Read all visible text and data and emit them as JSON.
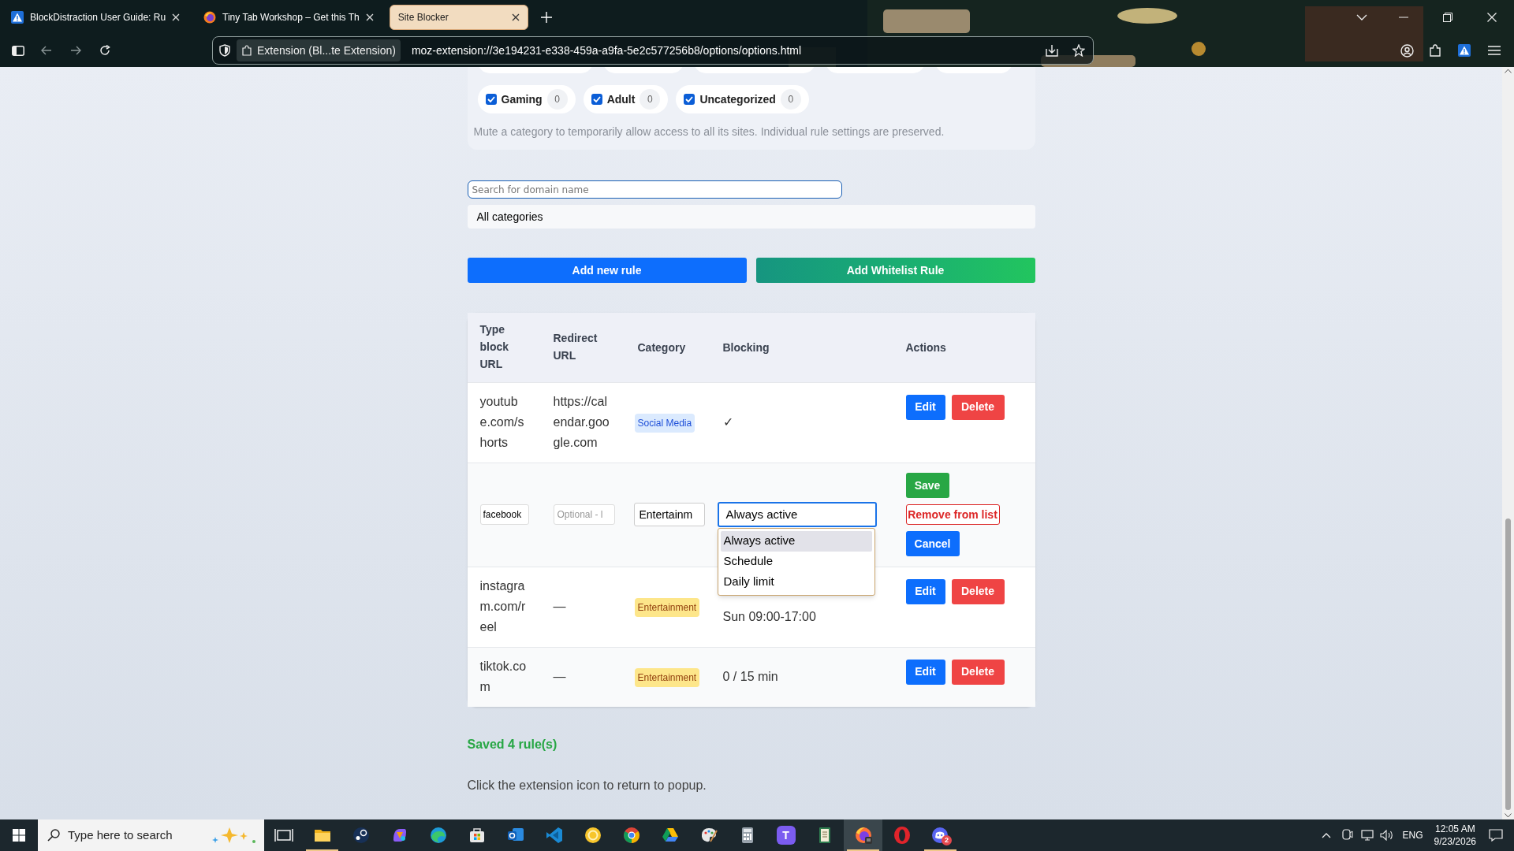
{
  "browser": {
    "tabs": [
      {
        "title": "BlockDistraction User Guide: Ru",
        "selected": false
      },
      {
        "title": "Tiny Tab Workshop – Get this Th",
        "selected": false
      },
      {
        "title": "Site Blocker",
        "selected": true
      }
    ],
    "identity": "Extension (Bl...te Extension)",
    "url": "moz-extension://3e194231-e338-459a-a9fa-5e2c577256b8/options/options.html"
  },
  "category_filters": [
    {
      "label": "Gaming",
      "count": "0",
      "checked": true
    },
    {
      "label": "Adult",
      "count": "0",
      "checked": true
    },
    {
      "label": "Uncategorized",
      "count": "0",
      "checked": true
    }
  ],
  "mute_note": "Mute a category to temporarily allow access to all its sites. Individual rule settings are preserved.",
  "search": {
    "placeholder": "Search for domain name"
  },
  "category_select": {
    "value": "All categories"
  },
  "buttons": [
    {
      "label": "Add new rule",
      "kind": "primary"
    },
    {
      "label": "Add Whitelist Rule",
      "kind": "whitelist"
    }
  ],
  "table": {
    "columns": [
      "Type block URL",
      "Redirect URL",
      "Category",
      "Blocking",
      "Actions"
    ],
    "rows": [
      {
        "kind": "view",
        "url": "youtube.com/shorts",
        "redirect": "https://calendar.google.com",
        "category": {
          "label": "Social Media",
          "color": "#dbeafe"
        },
        "blocking": "✓",
        "actions": [
          "Edit",
          "Delete"
        ]
      },
      {
        "kind": "edit",
        "url_value": "facebook",
        "redirect_placeholder": "Optional - l",
        "category_value": "Entertainm",
        "blocking_value": "Always active",
        "dropdown": {
          "expanded": true,
          "options": [
            {
              "label": "Always active",
              "selected": true
            },
            {
              "label": "Schedule",
              "selected": false
            },
            {
              "label": "Daily limit",
              "selected": false
            }
          ]
        },
        "actions": [
          {
            "label": "Save",
            "kind": "save"
          },
          {
            "label": "Remove from list",
            "kind": "remove"
          },
          {
            "label": "Cancel",
            "kind": "cancel"
          }
        ]
      },
      {
        "kind": "view",
        "url": "instagram.com/reel",
        "redirect": "—",
        "category": {
          "label": "Entertainment",
          "color": "#fde68a"
        },
        "blocking": "Sun 09:00-17:00",
        "actions": [
          "Edit",
          "Delete"
        ]
      },
      {
        "kind": "view",
        "url": "tiktok.com",
        "redirect": "—",
        "category": {
          "label": "Entertainment",
          "color": "#fde68a"
        },
        "blocking": "0 / 15 min",
        "actions": [
          "Edit",
          "Delete"
        ]
      }
    ]
  },
  "status": "Saved 4 rule(s)",
  "hint": "Click the extension icon to return to popup.",
  "taskbar": {
    "search_placeholder": "Type here to search",
    "apps": [
      {
        "kind": "taskview",
        "running": false,
        "selected": false
      },
      {
        "kind": "files",
        "running": true,
        "selected": false
      },
      {
        "kind": "steam",
        "running": false,
        "selected": false
      },
      {
        "kind": "copilot",
        "running": false,
        "selected": false
      },
      {
        "kind": "edge",
        "running": false,
        "selected": false
      },
      {
        "kind": "store",
        "running": false,
        "selected": false
      },
      {
        "kind": "outlook",
        "running": false,
        "selected": false
      },
      {
        "kind": "vscode",
        "running": false,
        "selected": false
      },
      {
        "kind": "ring",
        "running": false,
        "selected": false
      },
      {
        "kind": "chrome",
        "running": false,
        "selected": false
      },
      {
        "kind": "drive",
        "running": false,
        "selected": false
      },
      {
        "kind": "paint",
        "running": false,
        "selected": false
      },
      {
        "kind": "calculator",
        "running": false,
        "selected": false
      },
      {
        "kind": "tile",
        "label": "T",
        "running": false,
        "selected": false
      },
      {
        "kind": "notes",
        "running": false,
        "selected": false
      },
      {
        "kind": "firefox",
        "running": true,
        "selected": true
      },
      {
        "kind": "opera",
        "running": false,
        "selected": false
      },
      {
        "kind": "discord",
        "badge": "2",
        "running": true,
        "selected": false
      }
    ],
    "language": "ENG",
    "time": "12:05 AM",
    "date": "9/23/2026"
  }
}
